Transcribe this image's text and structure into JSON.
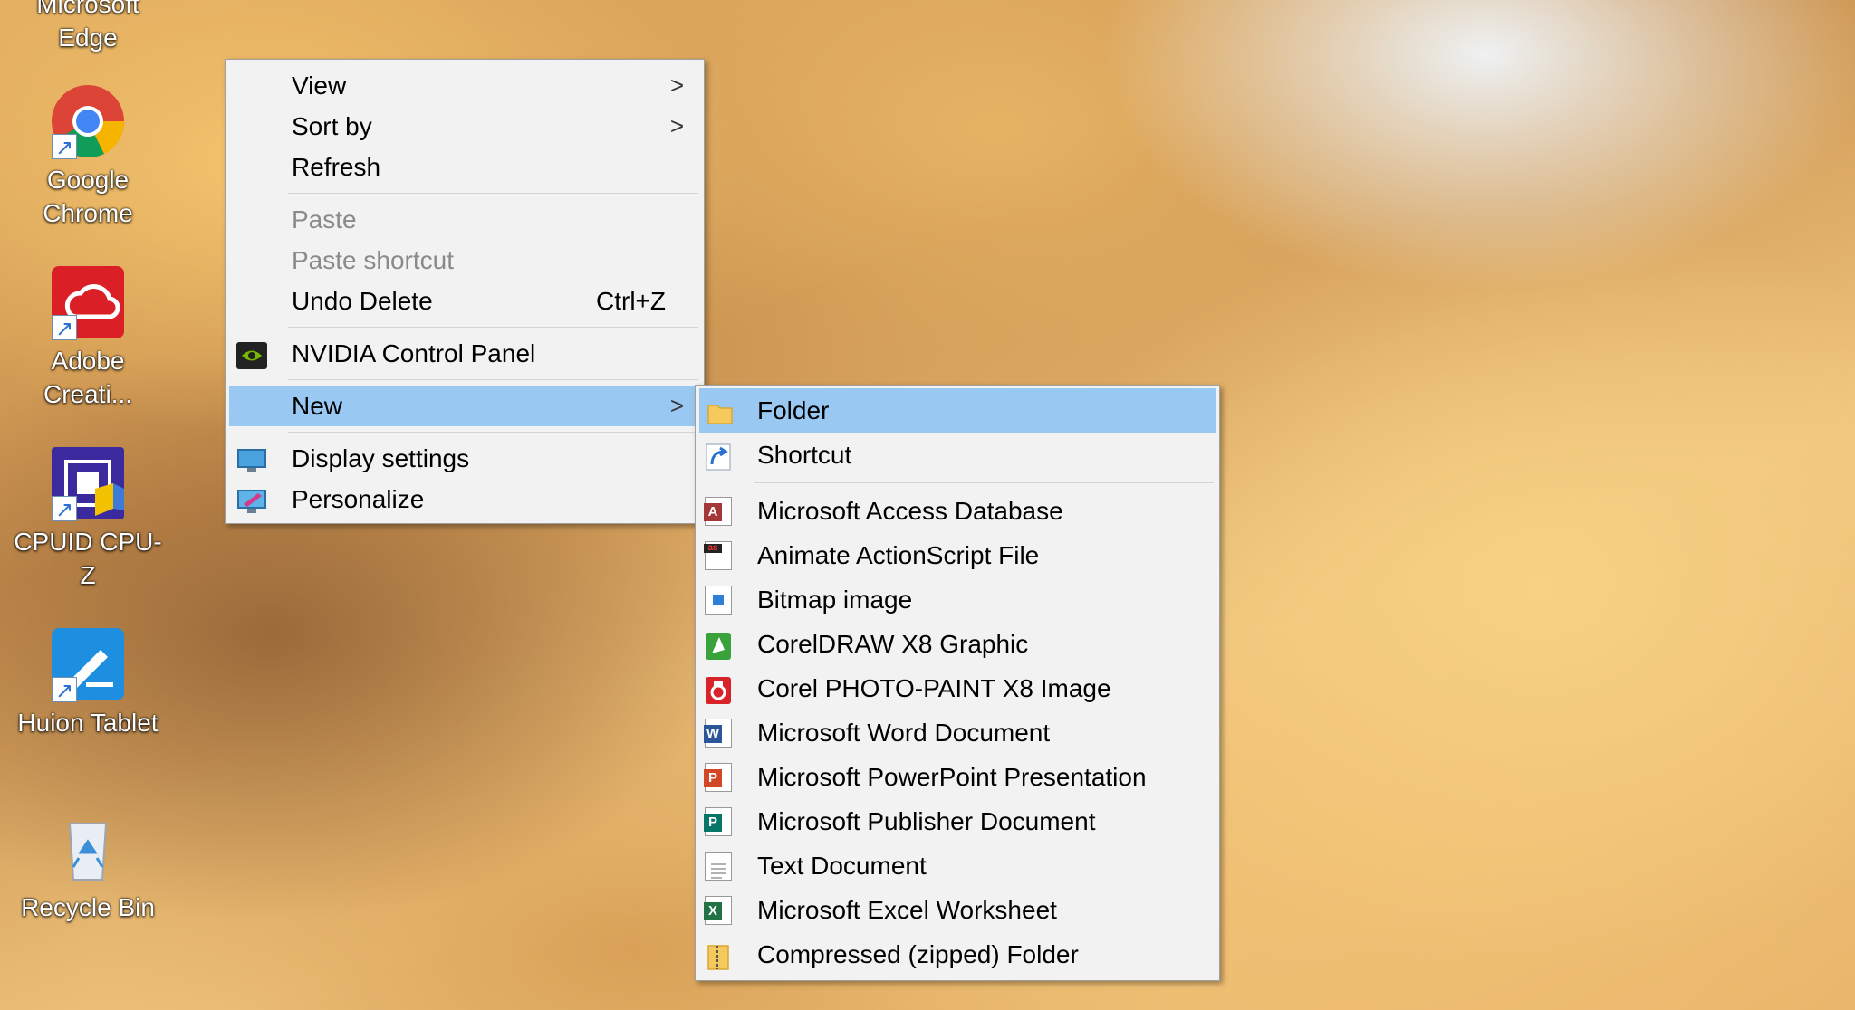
{
  "desktop": {
    "icons": [
      {
        "label_line1": "Microsoft",
        "label_line2": "Edge"
      },
      {
        "label_line1": "Google",
        "label_line2": "Chrome"
      },
      {
        "label_line1": "Adobe",
        "label_line2": "Creati..."
      },
      {
        "label_line1": "CPUID CPU-Z",
        "label_line2": ""
      },
      {
        "label_line1": "Huion Tablet",
        "label_line2": ""
      },
      {
        "label_line1": "Recycle Bin",
        "label_line2": ""
      }
    ]
  },
  "context_menu": {
    "items": [
      {
        "label": "View"
      },
      {
        "label": "Sort by"
      },
      {
        "label": "Refresh"
      },
      {
        "label": "Paste"
      },
      {
        "label": "Paste shortcut"
      },
      {
        "label": "Undo Delete",
        "shortcut": "Ctrl+Z"
      },
      {
        "label": "NVIDIA Control Panel"
      },
      {
        "label": "New"
      },
      {
        "label": "Display settings"
      },
      {
        "label": "Personalize"
      }
    ],
    "chevron": ">"
  },
  "new_submenu": {
    "items": [
      {
        "label": "Folder"
      },
      {
        "label": "Shortcut"
      },
      {
        "label": "Microsoft Access Database"
      },
      {
        "label": "Animate ActionScript File"
      },
      {
        "label": "Bitmap image"
      },
      {
        "label": "CorelDRAW X8 Graphic"
      },
      {
        "label": "Corel PHOTO-PAINT X8 Image"
      },
      {
        "label": "Microsoft Word Document"
      },
      {
        "label": "Microsoft PowerPoint Presentation"
      },
      {
        "label": "Microsoft Publisher Document"
      },
      {
        "label": "Text Document"
      },
      {
        "label": "Microsoft Excel Worksheet"
      },
      {
        "label": "Compressed (zipped) Folder"
      }
    ]
  },
  "colors": {
    "highlight": "#99c9f3",
    "menu_bg": "#f2f2f2",
    "disabled_text": "#8a8a8a"
  }
}
